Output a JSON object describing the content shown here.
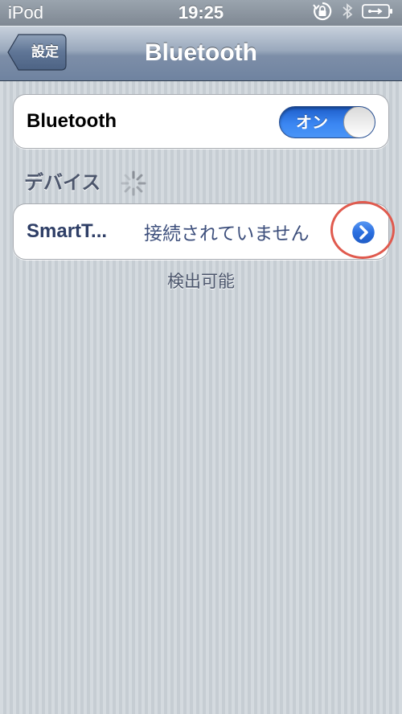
{
  "status_bar": {
    "carrier": "iPod",
    "time": "19:25",
    "icons": [
      "orientation-lock-icon",
      "bluetooth-icon",
      "battery-charging-icon"
    ]
  },
  "nav": {
    "back_label": "設定",
    "title": "Bluetooth"
  },
  "bluetooth_toggle": {
    "label": "Bluetooth",
    "state_label": "オン",
    "on": true,
    "on_color": "#3a86f2"
  },
  "devices_section": {
    "header": "デバイス",
    "searching_icon": "activity-spinner-icon",
    "devices": [
      {
        "name": "SmartT...",
        "status": "接続されていません",
        "detail_icon": "detail-disclosure-icon"
      }
    ],
    "footer": "検出可能"
  },
  "colors": {
    "nav_gradient_bottom": "#6f83a0",
    "highlight_ring": "#e05a4e",
    "device_text": "#2e3e66"
  }
}
